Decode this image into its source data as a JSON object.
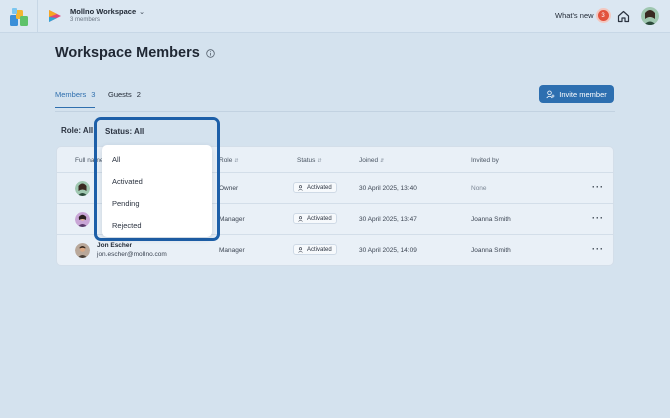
{
  "topbar": {
    "workspace_name": "Mollno Workspace",
    "workspace_members": "3 members",
    "whats_new": "What's new",
    "whats_new_count": "3"
  },
  "page": {
    "title": "Workspace Members"
  },
  "tabs": [
    {
      "label": "Members",
      "count": "3"
    },
    {
      "label": "Guests",
      "count": "2"
    }
  ],
  "invite_button": "Invite member",
  "filters": {
    "role": "Role: All",
    "status": "Status: All",
    "status_options": [
      "All",
      "Activated",
      "Pending",
      "Rejected"
    ]
  },
  "table": {
    "headers": {
      "full_name": "Full name",
      "role": "Role",
      "status": "Status",
      "joined": "Joined",
      "invited_by": "Invited by"
    },
    "rows": [
      {
        "name": "",
        "email": "",
        "role": "Owner",
        "status": "Activated",
        "joined": "30 April 2025, 13:40",
        "invited_by": "None"
      },
      {
        "name": "",
        "email": "",
        "role": "Manager",
        "status": "Activated",
        "joined": "30 April 2025, 13:47",
        "invited_by": "Joanna Smith"
      },
      {
        "name": "Jon Escher",
        "email": "jon.escher@mollno.com",
        "role": "Manager",
        "status": "Activated",
        "joined": "30 April 2025, 14:09",
        "invited_by": "Joanna Smith"
      }
    ]
  },
  "colors": {
    "accent": "#2d6fb0",
    "badge": "#e2523d",
    "background": "#d4e2ee"
  }
}
